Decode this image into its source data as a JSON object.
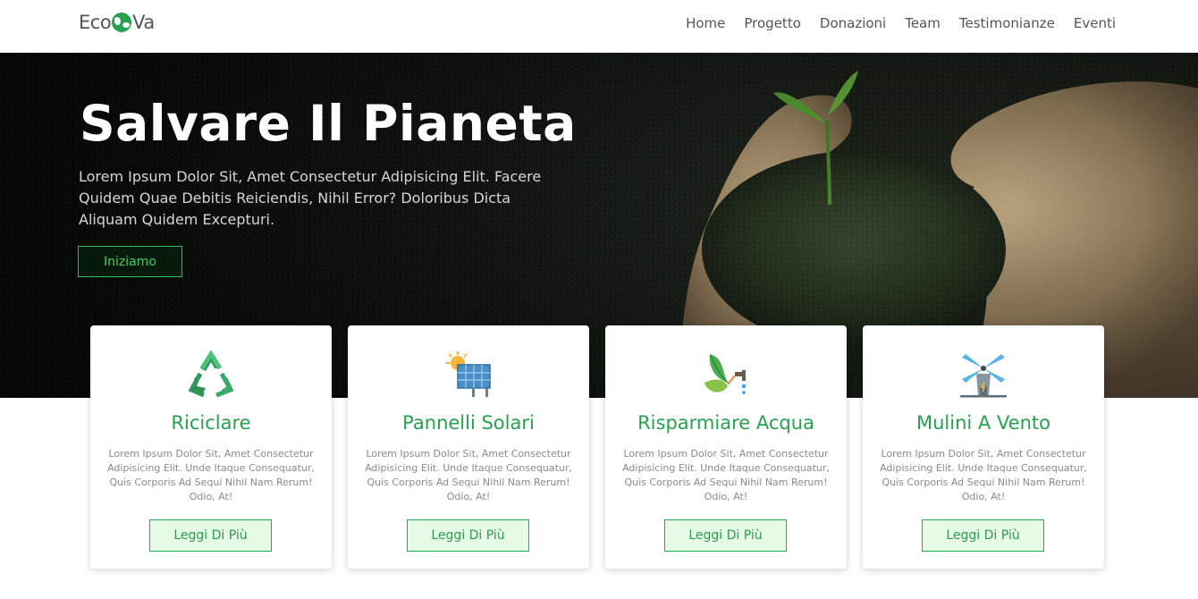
{
  "brand": {
    "prefix": "Eco",
    "suffix": "Va"
  },
  "nav": {
    "items": [
      {
        "label": "Home"
      },
      {
        "label": "Progetto"
      },
      {
        "label": "Donazioni"
      },
      {
        "label": "Team"
      },
      {
        "label": "Testimonianze"
      },
      {
        "label": "Eventi"
      }
    ]
  },
  "hero": {
    "title": "Salvare Il Pianeta",
    "text": "Lorem Ipsum Dolor Sit, Amet Consectetur Adipisicing Elit. Facere Quidem Quae Debitis Reiciendis, Nihil Error? Doloribus Dicta Aliquam Quidem Excepturi.",
    "button": "Iniziamo"
  },
  "cards": [
    {
      "icon": "recycle-icon",
      "title": "Riciclare",
      "text": "Lorem Ipsum Dolor Sit, Amet Consectetur Adipisicing Elit. Unde Itaque Consequatur, Quis Corporis Ad Sequi Nihil Nam Rerum! Odio, At!",
      "button": "Leggi Di Più"
    },
    {
      "icon": "solar-panel-icon",
      "title": "Pannelli Solari",
      "text": "Lorem Ipsum Dolor Sit, Amet Consectetur Adipisicing Elit. Unde Itaque Consequatur, Quis Corporis Ad Sequi Nihil Nam Rerum! Odio, At!",
      "button": "Leggi Di Più"
    },
    {
      "icon": "leaf-faucet-icon",
      "title": "Risparmiare Acqua",
      "text": "Lorem Ipsum Dolor Sit, Amet Consectetur Adipisicing Elit. Unde Itaque Consequatur, Quis Corporis Ad Sequi Nihil Nam Rerum! Odio, At!",
      "button": "Leggi Di Più"
    },
    {
      "icon": "windmill-icon",
      "title": "Mulini A Vento",
      "text": "Lorem Ipsum Dolor Sit, Amet Consectetur Adipisicing Elit. Unde Itaque Consequatur, Quis Corporis Ad Sequi Nihil Nam Rerum! Odio, At!",
      "button": "Leggi Di Più"
    }
  ],
  "colors": {
    "accent": "#27a14f",
    "hero_button": "#2fc25b",
    "card_button_bg": "#e6fbe6"
  }
}
